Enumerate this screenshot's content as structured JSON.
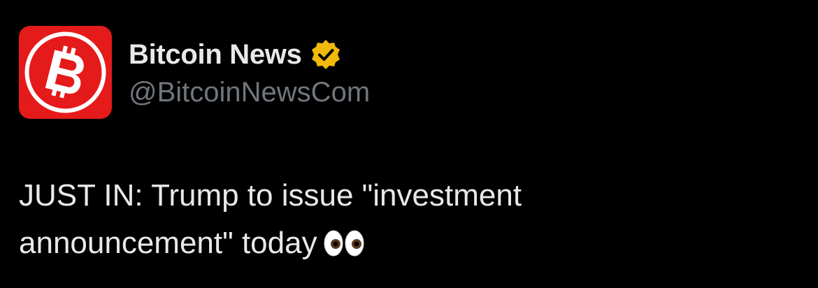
{
  "author": {
    "display_name": "Bitcoin News",
    "handle": "@BitcoinNewsCom",
    "avatar_icon": "bitcoin-logo-icon",
    "verified": true,
    "verified_badge_color": "#f0b90b",
    "avatar_color": "#e51a1a"
  },
  "tweet": {
    "text_line1": "JUST IN: Trump to issue \"investment",
    "text_line2": "announcement\" today",
    "emoji": "eyes-emoji"
  },
  "colors": {
    "background": "#000000",
    "primary_text": "#e7e9ea",
    "secondary_text": "#71767b"
  }
}
